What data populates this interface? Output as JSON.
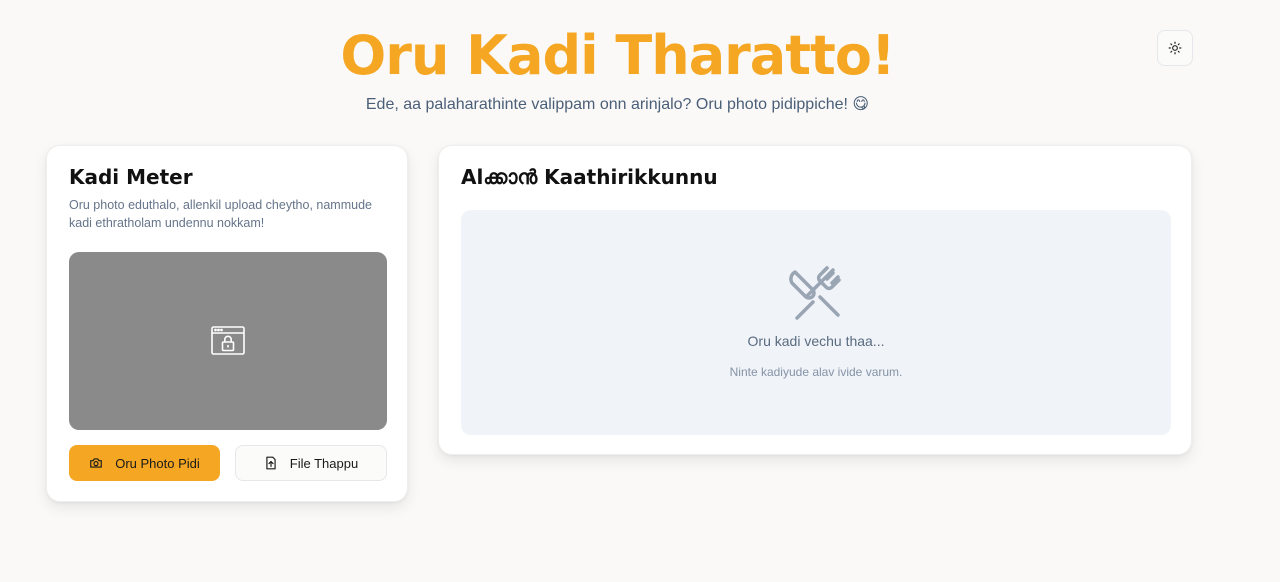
{
  "header": {
    "title": "Oru Kadi Tharatto!",
    "subtitle": "Ede, aa palaharathinte valippam onn arinjalo? Oru photo pidippiche! 😋"
  },
  "theme_toggle": {
    "icon": "sun-icon"
  },
  "scanner": {
    "title": "Kadi Meter",
    "description": "Oru photo eduthalo, allenkil upload cheytho, nammude kadi ethratholam undennu nokkam!",
    "preview_icon": "camera-blocked-icon",
    "camera_button": "Oru Photo Pidi",
    "upload_button": "File Thappu"
  },
  "result": {
    "title": "Alക്കാൻ Kaathirikkunnu",
    "empty_icon": "utensils-crossed-icon",
    "empty_title": "Oru kadi vechu thaa...",
    "empty_text": "Ninte kadiyude alav ivide varum."
  },
  "colors": {
    "accent": "#f5a623",
    "background": "#faf9f7",
    "preview": "#8a8a8a",
    "empty_state": "#f0f3f8"
  }
}
